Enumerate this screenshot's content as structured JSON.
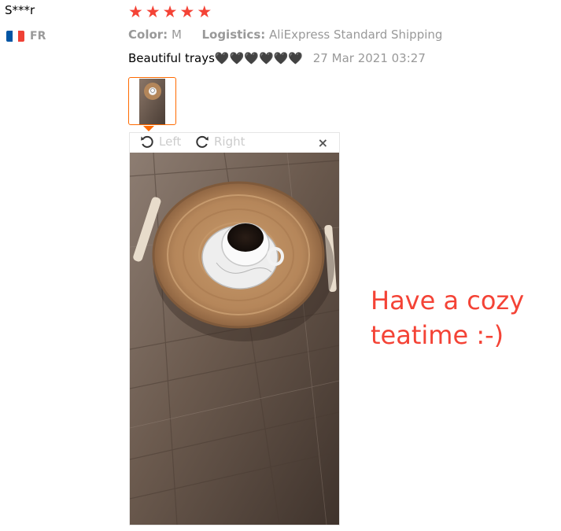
{
  "review": {
    "user_name": "S***r",
    "country_code": "FR",
    "flag_colors": [
      "#0055a4",
      "#ffffff",
      "#ef4135"
    ],
    "rating": 5,
    "stars": [
      "★",
      "★",
      "★",
      "★",
      "★"
    ],
    "star_color": "#f44336",
    "attributes": {
      "color_label": "Color:",
      "color_value": "M",
      "logistics_label": "Logistics:",
      "logistics_value": "AliExpress Standard Shipping"
    },
    "feedback_text": "Beautiful trays🖤🖤🖤🖤🖤🖤",
    "date": "27 Mar 2021 03:27"
  },
  "viewer": {
    "rotate_left_label": "Left",
    "rotate_right_label": "Right",
    "close_symbol": "×",
    "rotate_left_icon": "rotate-ccw-icon",
    "rotate_right_icon": "rotate-cw-icon",
    "photo": "rattan-tray-with-coffee-cup-on-wooden-table"
  },
  "annotation": {
    "caption": "Have a cozy teatime :-)",
    "color": "#f44336"
  }
}
